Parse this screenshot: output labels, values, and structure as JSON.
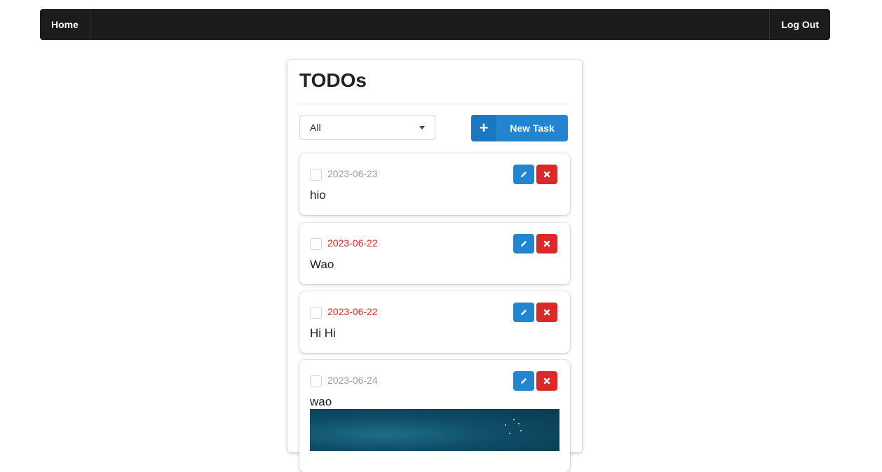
{
  "nav": {
    "home_label": "Home",
    "logout_label": "Log Out"
  },
  "panel": {
    "title": "TODOs",
    "filter": {
      "selected": "All"
    },
    "new_task_label": "New Task"
  },
  "tasks": [
    {
      "date": "2023-06-23",
      "date_color": "#9e9e9e",
      "text": "hio",
      "checked": false
    },
    {
      "date": "2023-06-22",
      "date_color": "#db2828",
      "text": "Wao",
      "checked": false
    },
    {
      "date": "2023-06-22",
      "date_color": "#db2828",
      "text": "Hi Hi",
      "checked": false
    },
    {
      "date": "2023-06-24",
      "date_color": "#9e9e9e",
      "text": "wao",
      "checked": false,
      "has_image": true
    }
  ],
  "colors": {
    "navbar_bg": "#1b1c1d",
    "primary": "#2185d0",
    "danger": "#db2828",
    "overdue_date": "#db2828",
    "normal_date": "#9e9e9e"
  }
}
